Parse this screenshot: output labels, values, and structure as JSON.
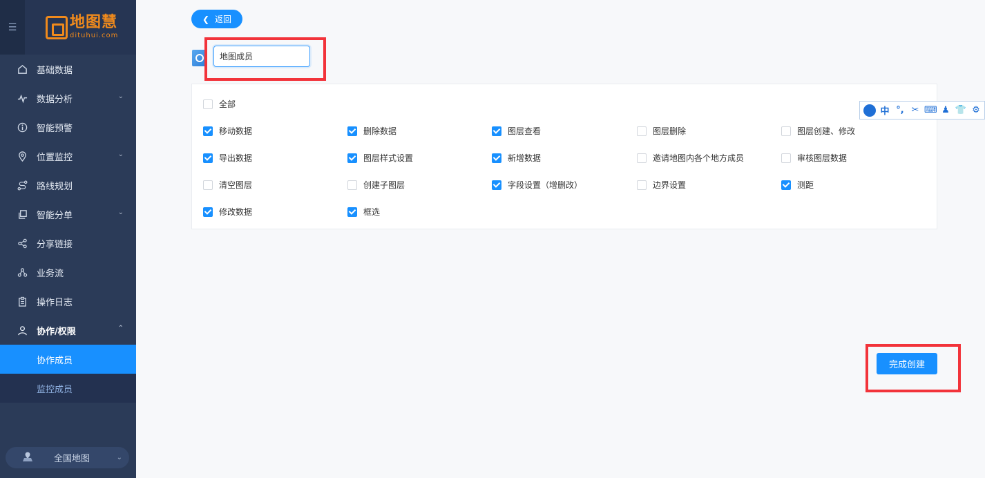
{
  "sidebar": {
    "logo": {
      "cn": "地图慧",
      "en": "dituhui.com"
    },
    "menu": [
      {
        "label": "基础数据",
        "icon": "home-icon",
        "has_children": false
      },
      {
        "label": "数据分析",
        "icon": "activity-icon",
        "has_children": true
      },
      {
        "label": "智能预警",
        "icon": "info-icon",
        "has_children": false
      },
      {
        "label": "位置监控",
        "icon": "location-pin-icon",
        "has_children": true
      },
      {
        "label": "路线规划",
        "icon": "route-icon",
        "has_children": false
      },
      {
        "label": "智能分单",
        "icon": "copy-icon",
        "has_children": true
      },
      {
        "label": "分享链接",
        "icon": "share-icon",
        "has_children": false
      },
      {
        "label": "业务流",
        "icon": "workflow-icon",
        "has_children": false
      },
      {
        "label": "操作日志",
        "icon": "clipboard-icon",
        "has_children": false
      },
      {
        "label": "协作/权限",
        "icon": "user-icon",
        "has_children": true,
        "expanded": true
      }
    ],
    "submenu": [
      {
        "label": "协作成员",
        "active": true
      },
      {
        "label": "监控成员",
        "active": false
      }
    ],
    "map_switch": {
      "label": "全国地图"
    }
  },
  "main": {
    "back_label": "返回",
    "name_input": {
      "value": "地图成员"
    },
    "permissions": {
      "all": {
        "label": "全部",
        "checked": false
      },
      "items": [
        {
          "label": "移动数据",
          "checked": true
        },
        {
          "label": "删除数据",
          "checked": true
        },
        {
          "label": "图层查看",
          "checked": true
        },
        {
          "label": "图层删除",
          "checked": false
        },
        {
          "label": "图层创建、修改",
          "checked": false
        },
        {
          "label": "导出数据",
          "checked": true
        },
        {
          "label": "图层样式设置",
          "checked": true
        },
        {
          "label": "新增数据",
          "checked": true
        },
        {
          "label": "邀请地图内各个地方成员",
          "checked": false
        },
        {
          "label": "审核图层数据",
          "checked": false
        },
        {
          "label": "清空图层",
          "checked": false
        },
        {
          "label": "创建子图层",
          "checked": false
        },
        {
          "label": "字段设置（增删改）",
          "checked": true
        },
        {
          "label": "边界设置",
          "checked": false
        },
        {
          "label": "测距",
          "checked": true
        },
        {
          "label": "修改数据",
          "checked": true
        },
        {
          "label": "框选",
          "checked": true
        }
      ]
    },
    "finish_label": "完成创建"
  },
  "ime_toolbar": {
    "mode_label": "中",
    "punct_label": "°,"
  },
  "colors": {
    "primary": "#1890ff",
    "sidebar_bg": "#2b3b58",
    "logo_orange": "#f08a1c",
    "highlight_red": "#f2333a"
  }
}
